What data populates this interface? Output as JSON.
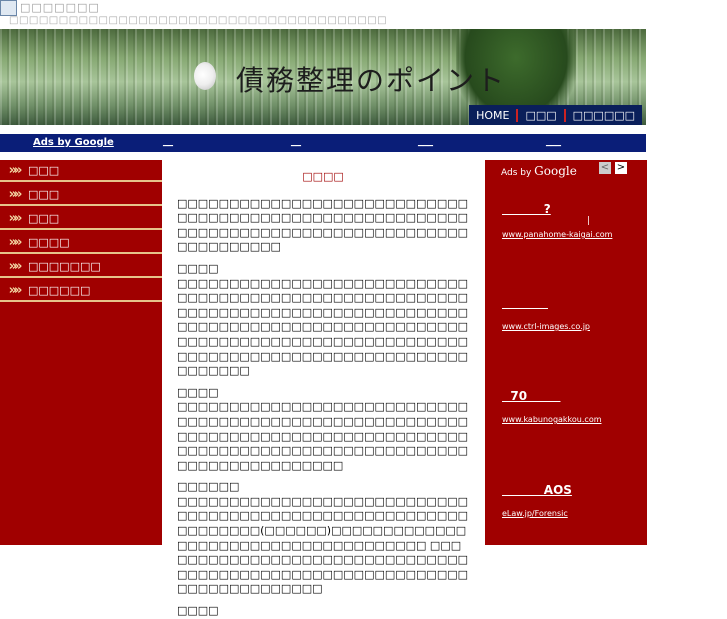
{
  "topbar": {
    "title": "□□□□□□□",
    "subtitle": "□□□□□□□□□□□□□□□□□□□□□□□□□□□□□□□□□□□□□□"
  },
  "banner": {
    "logo_text": "債務整理のポイント",
    "nav": [
      "HOME",
      "□□□",
      "□□□□□□"
    ]
  },
  "adbar": {
    "label": "Ads by Google",
    "links": [
      "__",
      "__",
      "___",
      "___"
    ]
  },
  "sidebar": {
    "items": [
      {
        "arrow": "»»",
        "label": "□□□"
      },
      {
        "arrow": "»»",
        "label": "□□□"
      },
      {
        "arrow": "»»",
        "label": "□□□"
      },
      {
        "arrow": "»»",
        "label": "□□□□"
      },
      {
        "arrow": "»»",
        "label": "□□□□□□□"
      },
      {
        "arrow": "»»",
        "label": "□□□□□□"
      }
    ]
  },
  "main": {
    "heading": "□□□□",
    "intro": "□□□□□□□□□□□□□□□□□□□□□□□□□□□□□□□□□□□□□□□□□□□□□□□□□□□□□□□□□□□□□□□□□□□□□□□□□□□□□□□□□□□□□□□□□□□□□□",
    "sections": [
      {
        "title": "□□□□",
        "body": "□□□□□□□□□□□□□□□□□□□□□□□□□□□□□□□□□□□□□□□□□□□□□□□□□□□□□□□□□□□□□□□□□□□□□□□□□□□□□□□□□□□□□□□□□□□□□□□□□□□□□□□□□□□□□□□□□□□□□□□□□□□□□□□□□□□□□□□□□□□□□□□□□□□□□□□□□□□□□□□□□□□□□□□□□□□□□□□"
      },
      {
        "title": "□□□□",
        "body": "□□□□□□□□□□□□□□□□□□□□□□□□□□□□□□□□□□□□□□□□□□□□□□□□□□□□□□□□□□□□□□□□□□□□□□□□□□□□□□□□□□□□□□□□□□□□□□□□□□□□□□□□□□□□□□□□□□□□□□□□□□□□□□□□"
      },
      {
        "title": "□□□□□□",
        "body": "□□□□□□□□□□□□□□□□□□□□□□□□□□□□□□□□□□□□□□□□□□□□□□□□□□□□□□□□□□□□□□□□(□□□□□□)□□□□□□□□□□□□□□□□□□□□□□□□□□□□□□□□□□□□□ □□□□□□□□□□□□□□□□□□□□□□□□□□□□□□□□□□□□□□□□□□□□□□□□□□□□□□□□□□□□□□□□□□□□□□□□□"
      },
      {
        "title": "□□□□",
        "body": ""
      }
    ]
  },
  "rightads": {
    "label_prefix": "Ads by ",
    "label_brand": "Google",
    "prev": "<",
    "next": ">",
    "ads": [
      {
        "title": "          ?",
        "extra": "|",
        "url": "www.panahome-kaigai.com"
      },
      {
        "title": "           ",
        "extra": "",
        "url": "www.ctrl-images.co.jp"
      },
      {
        "title": "  70        ",
        "extra": "",
        "url": "www.kabunogakkou.com"
      },
      {
        "title": "          AOS",
        "extra": "",
        "url": "eLaw.jp/Forensic"
      }
    ]
  },
  "colors": {
    "accent_red": "#a00000",
    "navy": "#0a1e78",
    "divider_gold": "#e7c38a"
  }
}
